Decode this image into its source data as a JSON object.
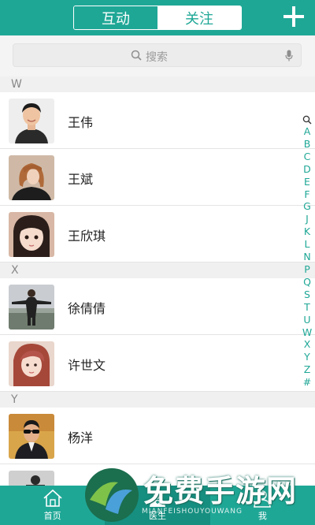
{
  "header": {
    "tabs": [
      {
        "label": "互动",
        "active": true
      },
      {
        "label": "关注",
        "active": false
      }
    ],
    "add_icon": "plus-icon"
  },
  "search": {
    "placeholder": "搜索",
    "icon": "search-icon",
    "voice_icon": "microphone-icon"
  },
  "contacts": {
    "sections": [
      {
        "letter": "W",
        "items": [
          {
            "name": "王伟",
            "avatar": "man-portrait"
          },
          {
            "name": "王斌",
            "avatar": "woman-bob-hair"
          },
          {
            "name": "王欣琪",
            "avatar": "girl-portrait"
          }
        ]
      },
      {
        "letter": "X",
        "items": [
          {
            "name": "徐倩倩",
            "avatar": "person-outdoors"
          },
          {
            "name": "许世文",
            "avatar": "woman-red-hair"
          }
        ]
      },
      {
        "letter": "Y",
        "items": [
          {
            "name": "杨洋",
            "avatar": "man-sunglasses"
          },
          {
            "name": "",
            "avatar": "person-partial"
          }
        ]
      }
    ]
  },
  "index_bar": [
    "A",
    "B",
    "C",
    "D",
    "E",
    "F",
    "G",
    "J",
    "K",
    "L",
    "N",
    "P",
    "Q",
    "S",
    "T",
    "U",
    "W",
    "X",
    "Y",
    "Z",
    "#"
  ],
  "tabbar": {
    "items": [
      {
        "label": "首页",
        "icon": "home-icon",
        "selected": false
      },
      {
        "label": "医生",
        "icon": "doctor-icon",
        "selected": true
      },
      {
        "label": "我",
        "icon": "user-icon",
        "selected": false
      }
    ]
  },
  "watermark": {
    "text": "免费手游网",
    "subtext": "MIANFEISHOUYOUWANG"
  },
  "colors": {
    "accent": "#1fa796",
    "accent_dark": "#168f80",
    "section_bg": "#f0f0f0"
  }
}
